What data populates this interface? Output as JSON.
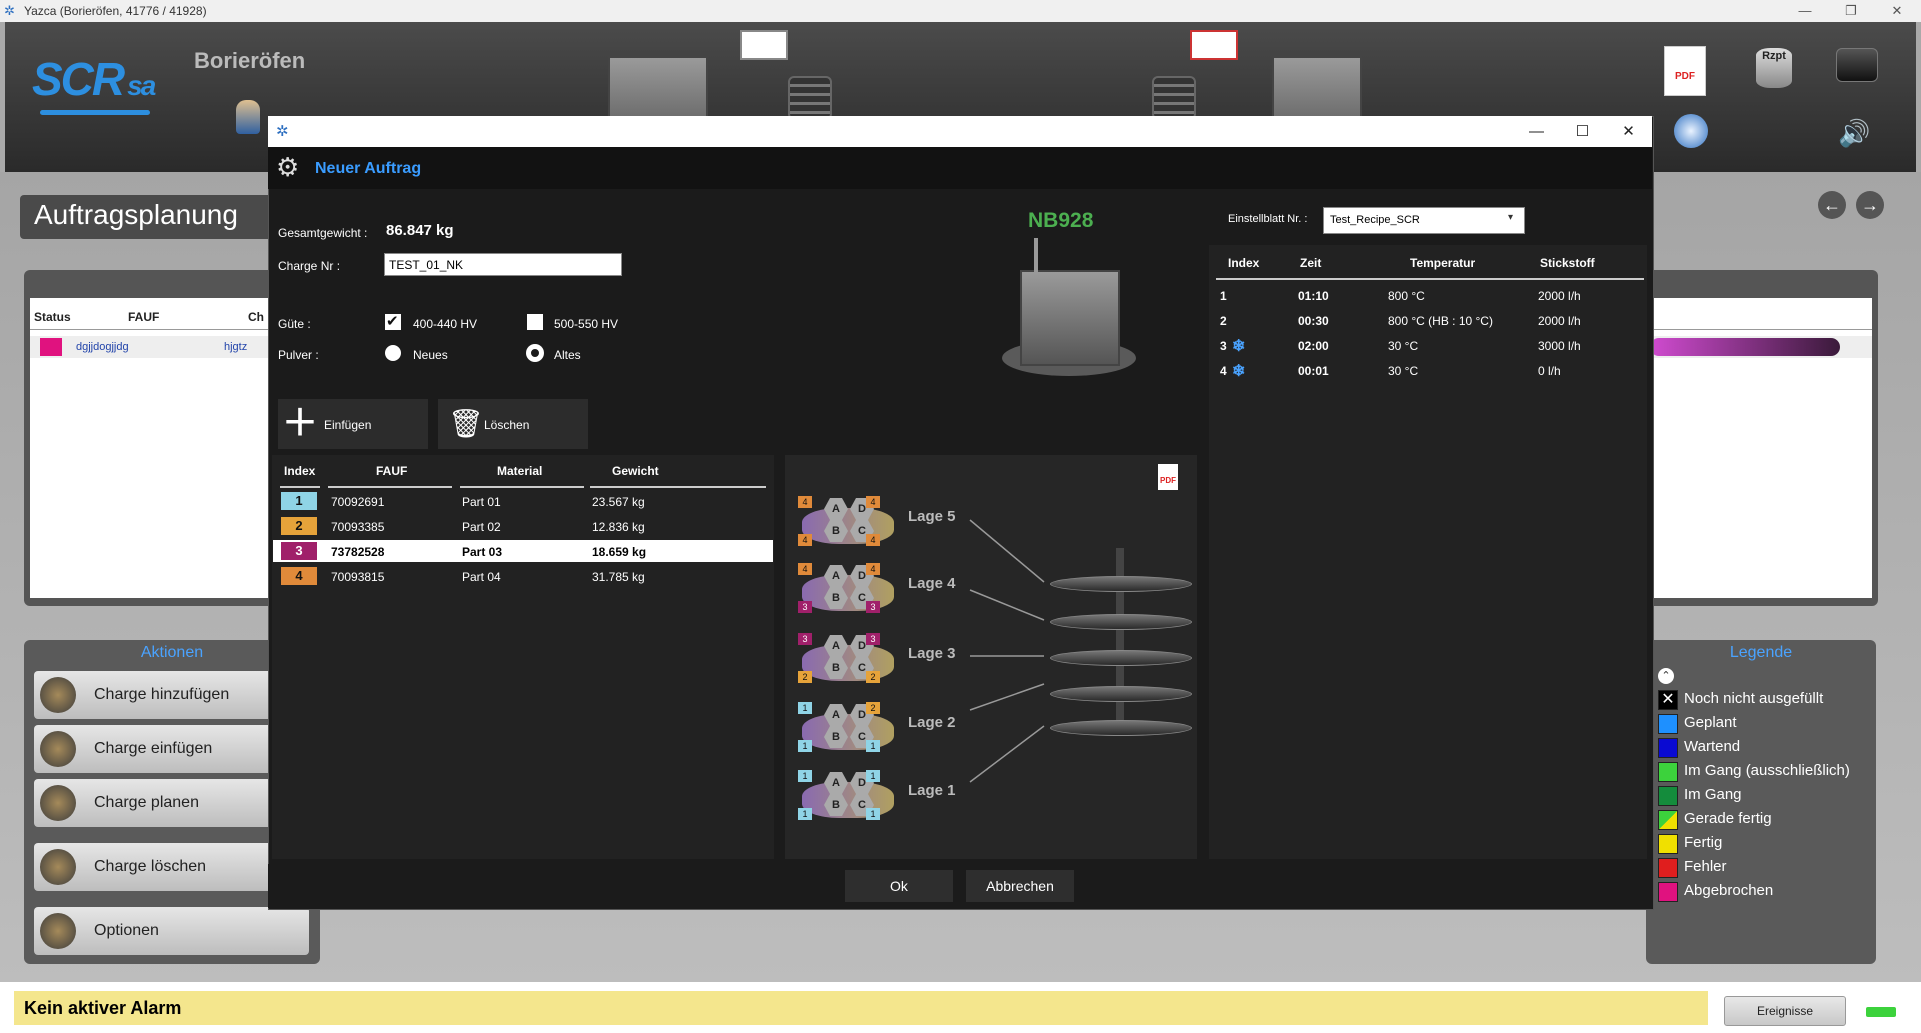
{
  "window": {
    "title": "Yazca (Borieröfen, 41776 / 41928)"
  },
  "header": {
    "logo": "SCR",
    "logo_suffix": "sa",
    "plant_name": "Borieröfen",
    "rzpt_label": "Rzpt",
    "pdf_label": "PDF"
  },
  "page": {
    "title": "Auftragsplanung"
  },
  "orders": {
    "columns": [
      "Status",
      "FAUF",
      "Ch"
    ],
    "rows": [
      {
        "status_color": "#e0127f",
        "fauf": "dgjjdogjjdg",
        "charge": "hjgtz"
      }
    ]
  },
  "actions": {
    "title": "Aktionen",
    "items": [
      "Charge hinzufügen",
      "Charge einfügen",
      "Charge planen",
      "Charge löschen",
      "Optionen"
    ]
  },
  "legend": {
    "title": "Legende",
    "items": [
      {
        "label": "Noch nicht ausgefüllt",
        "color": "#000000"
      },
      {
        "label": "Geplant",
        "color": "#1e90ff"
      },
      {
        "label": "Wartend",
        "color": "#0a0ad2"
      },
      {
        "label": "Im Gang (ausschließlich)",
        "color": "#3cd23c"
      },
      {
        "label": "Im Gang",
        "color": "#148c3c"
      },
      {
        "label": "Gerade fertig",
        "color": "#c8c820"
      },
      {
        "label": "Fertig",
        "color": "#f0e000"
      },
      {
        "label": "Fehler",
        "color": "#e01e1e"
      },
      {
        "label": "Abgebrochen",
        "color": "#e0127f"
      }
    ]
  },
  "alarm": {
    "text": "Kein aktiver Alarm",
    "events_label": "Ereignisse"
  },
  "dialog": {
    "title": "Neuer Auftrag",
    "total_weight_label": "Gesamtgewicht :",
    "total_weight_value": "86.847 kg",
    "charge_label": "Charge Nr :",
    "charge_value": "TEST_01_NK",
    "quality_label": "Güte :",
    "quality_opt1": "400-440 HV",
    "quality_opt2": "500-550 HV",
    "powder_label": "Pulver :",
    "powder_opt1": "Neues",
    "powder_opt2": "Altes",
    "insert_label": "Einfügen",
    "delete_label": "Löschen",
    "furnace_name": "NB928",
    "recipe_label": "Einstellblatt Nr. :",
    "recipe_value": "Test_Recipe_SCR",
    "ok_label": "Ok",
    "cancel_label": "Abbrechen",
    "items": {
      "columns": [
        "Index",
        "FAUF",
        "Material",
        "Gewicht"
      ],
      "rows": [
        {
          "index": "1",
          "fauf": "70092691",
          "material": "Part 01",
          "weight": "23.567 kg",
          "color": "#8fd4e6"
        },
        {
          "index": "2",
          "fauf": "70093385",
          "material": "Part 02",
          "weight": "12.836 kg",
          "color": "#e6a33a"
        },
        {
          "index": "3",
          "fauf": "73782528",
          "material": "Part 03",
          "weight": "18.659 kg",
          "color": "#a0206a"
        },
        {
          "index": "4",
          "fauf": "70093815",
          "material": "Part 04",
          "weight": "31.785 kg",
          "color": "#e08a3a"
        }
      ]
    },
    "layers": [
      {
        "label": "Lage 5",
        "slots": [
          "4",
          "4",
          "4",
          "4"
        ]
      },
      {
        "label": "Lage 4",
        "slots": [
          "4",
          "4",
          "3",
          "3"
        ]
      },
      {
        "label": "Lage 3",
        "slots": [
          "3",
          "3",
          "2",
          "2"
        ]
      },
      {
        "label": "Lage 2",
        "slots": [
          "1",
          "2",
          "1",
          "1"
        ]
      },
      {
        "label": "Lage 1",
        "slots": [
          "1",
          "1",
          "1",
          "1"
        ]
      }
    ],
    "hex_labels": [
      "A",
      "D",
      "B",
      "C"
    ],
    "recipe": {
      "columns": [
        "Index",
        "Zeit",
        "Temperatur",
        "Stickstoff"
      ],
      "rows": [
        {
          "index": "1",
          "cooling": false,
          "time": "01:10",
          "temp": "800 °C",
          "n2": "2000 l/h"
        },
        {
          "index": "2",
          "cooling": false,
          "time": "00:30",
          "temp": "800 °C (HB : 10 °C)",
          "n2": "2000 l/h"
        },
        {
          "index": "3",
          "cooling": true,
          "time": "02:00",
          "temp": "30 °C",
          "n2": "3000 l/h"
        },
        {
          "index": "4",
          "cooling": true,
          "time": "00:01",
          "temp": "30 °C",
          "n2": "0 l/h"
        }
      ]
    }
  }
}
